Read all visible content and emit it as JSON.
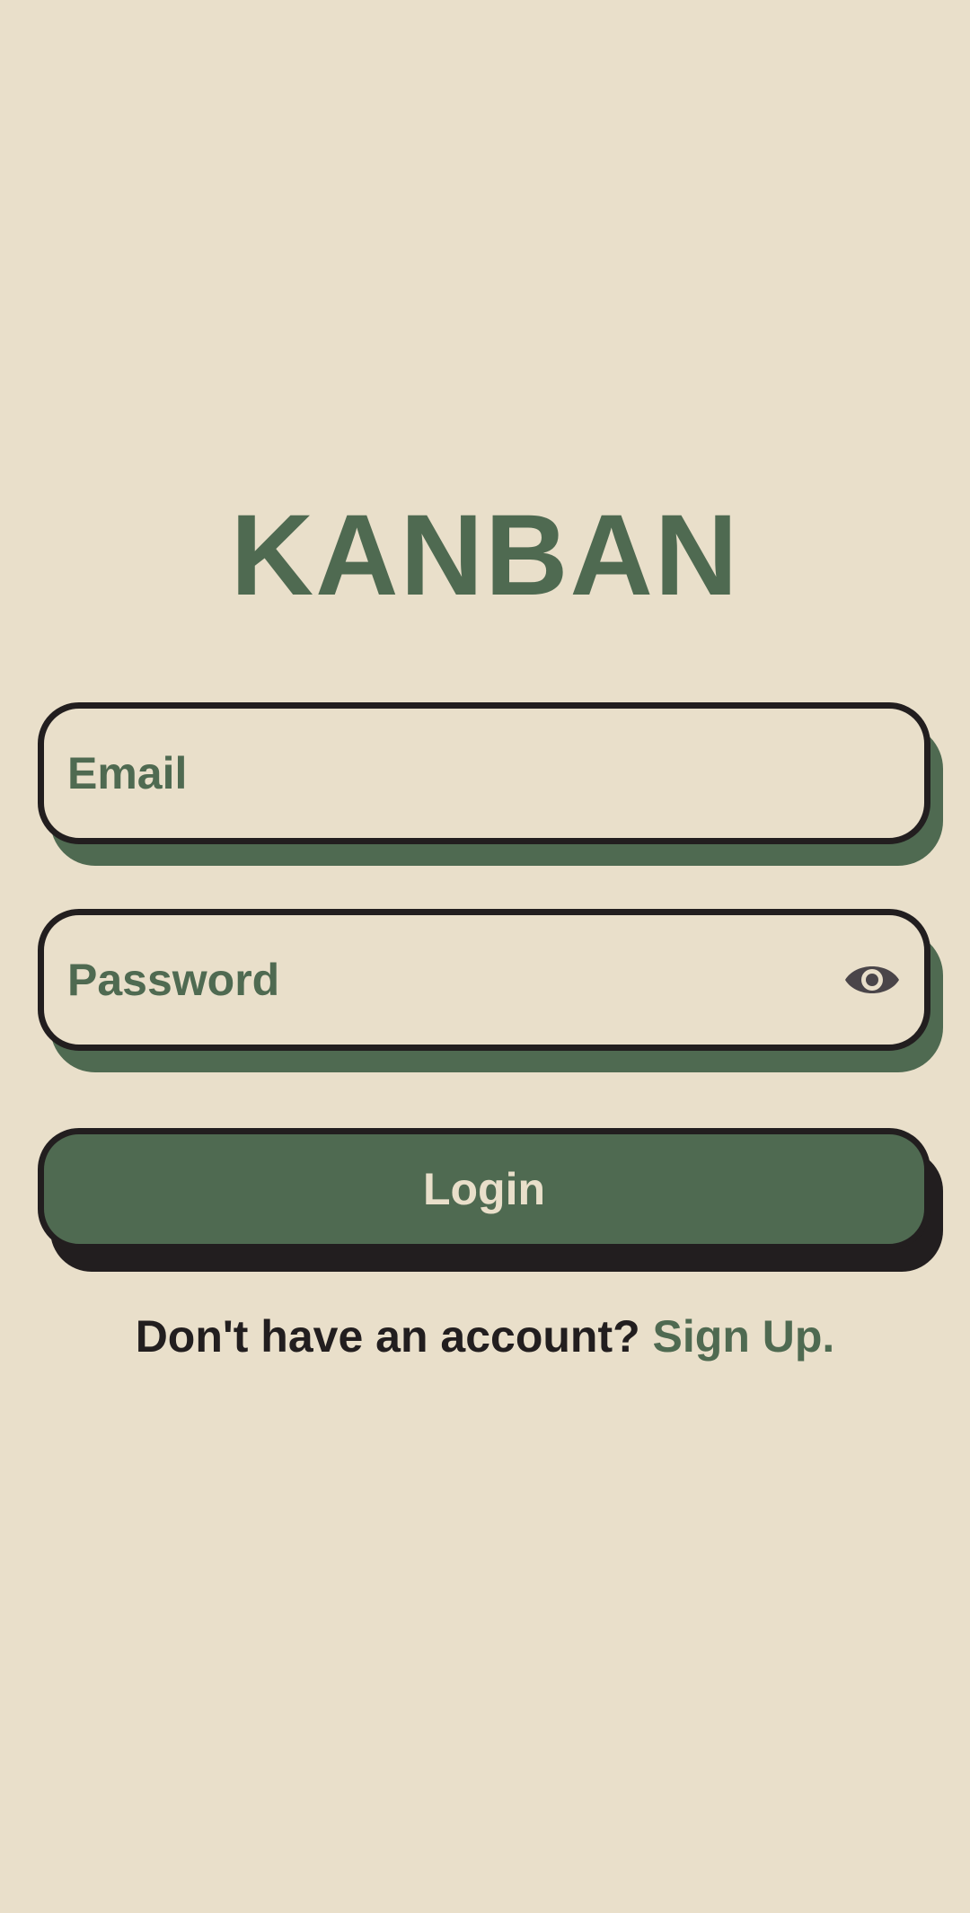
{
  "app": {
    "title": "KANBAN"
  },
  "form": {
    "email": {
      "placeholder": "Email",
      "value": ""
    },
    "password": {
      "placeholder": "Password",
      "value": "",
      "toggle_icon": "eye-icon"
    },
    "login_label": "Login"
  },
  "footer": {
    "prompt": "Don't have an account?",
    "signup_label": "Sign Up."
  },
  "colors": {
    "background": "#e9dfca",
    "accent": "#4f6a51",
    "outline": "#221e1f"
  }
}
